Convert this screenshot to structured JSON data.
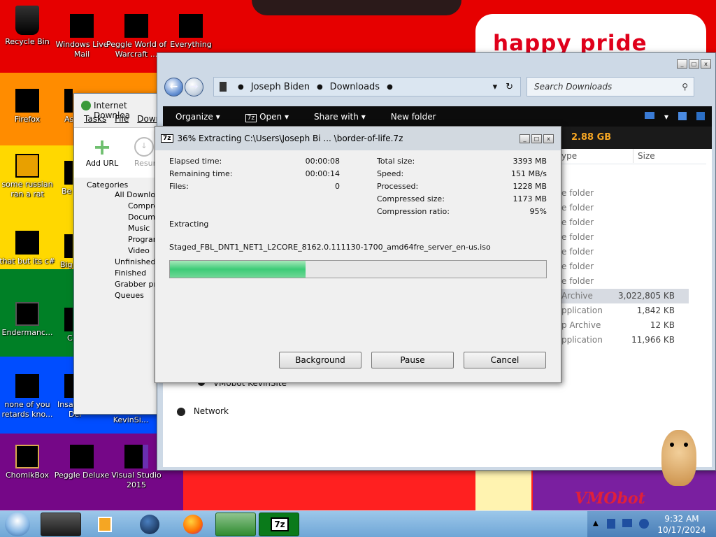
{
  "desktop": {
    "icons": [
      {
        "label": "Recycle Bin"
      },
      {
        "label": "Windows Live Mail"
      },
      {
        "label": "Peggle World of Warcraft ..."
      },
      {
        "label": "Everything"
      },
      {
        "label": "Firefox"
      },
      {
        "label": "As"
      },
      {
        "label": "some russian ran a rat"
      },
      {
        "label": "Be"
      },
      {
        "label": "that but its c#"
      },
      {
        "label": "Big"
      },
      {
        "label": "Endermanc..."
      },
      {
        "label": "C"
      },
      {
        "label": "none of you retards kno..."
      },
      {
        "label": "Insa"
      },
      {
        "label": "Deluxe"
      },
      {
        "label": "KevinSi..."
      },
      {
        "label": "ChomikBox"
      },
      {
        "label": "Peggle Deluxe"
      },
      {
        "label": "Visual Studio 2015"
      }
    ],
    "pride_text": "happy pride month",
    "wallpaper_text": "VMObot"
  },
  "explorer": {
    "breadcrumb": [
      "Joseph Biden",
      "Downloads"
    ],
    "search_placeholder": "Search Downloads",
    "toolbar": {
      "organize": "Organize",
      "open": "Open",
      "share_with": "Share with",
      "new_folder": "New folder"
    },
    "free_space": "2.88 GB",
    "columns": {
      "type": "ype",
      "size": "Size"
    },
    "rows": [
      {
        "type": "e folder",
        "size": ""
      },
      {
        "type": "e folder",
        "size": ""
      },
      {
        "type": "e folder",
        "size": ""
      },
      {
        "type": "e folder",
        "size": ""
      },
      {
        "type": "e folder",
        "size": ""
      },
      {
        "type": "e folder",
        "size": ""
      },
      {
        "type": "e folder",
        "size": ""
      },
      {
        "type": "Archive",
        "size": "3,022,805 KB"
      },
      {
        "type": "pplication",
        "size": "1,842 KB"
      },
      {
        "type": "p Archive",
        "size": "12 KB"
      },
      {
        "type": "pplication",
        "size": "11,966 KB"
      }
    ],
    "nav_items": {
      "vmobot": "VMobot KevinSite",
      "network": "Network"
    }
  },
  "idm": {
    "title": "Internet Downloa",
    "menu": [
      "Tasks",
      "File",
      "Down"
    ],
    "toolbar": {
      "add_url": "Add URL",
      "resume": "Resum"
    },
    "categories_label": "Categories",
    "tree": [
      "All Download",
      "Compres",
      "Docume",
      "Music",
      "Program",
      "Video",
      "Unfinished",
      "Finished",
      "Grabber pro",
      "Queues"
    ]
  },
  "sevenzip": {
    "title": "36% Extracting C:\\Users\\Joseph Bi ... \\border-of-life.7z",
    "progress_fraction": 0.36,
    "left_stats": [
      {
        "label": "Elapsed time:",
        "value": "00:00:08"
      },
      {
        "label": "Remaining time:",
        "value": "00:00:14"
      },
      {
        "label": "Files:",
        "value": "0"
      }
    ],
    "right_stats": [
      {
        "label": "Total size:",
        "value": "3393 MB"
      },
      {
        "label": "Speed:",
        "value": "151 MB/s"
      },
      {
        "label": "Processed:",
        "value": "1228 MB"
      },
      {
        "label": "Compressed size:",
        "value": "1173 MB"
      },
      {
        "label": "Compression ratio:",
        "value": "95%"
      }
    ],
    "status": "Extracting",
    "current_file": "Staged_FBL_DNT1_NET1_L2CORE_8162.0.111130-1700_amd64fre_server_en-us.iso",
    "buttons": {
      "background": "Background",
      "pause": "Pause",
      "cancel": "Cancel"
    }
  },
  "taskbar": {
    "time": "9:32 AM",
    "date": "10/17/2024"
  }
}
